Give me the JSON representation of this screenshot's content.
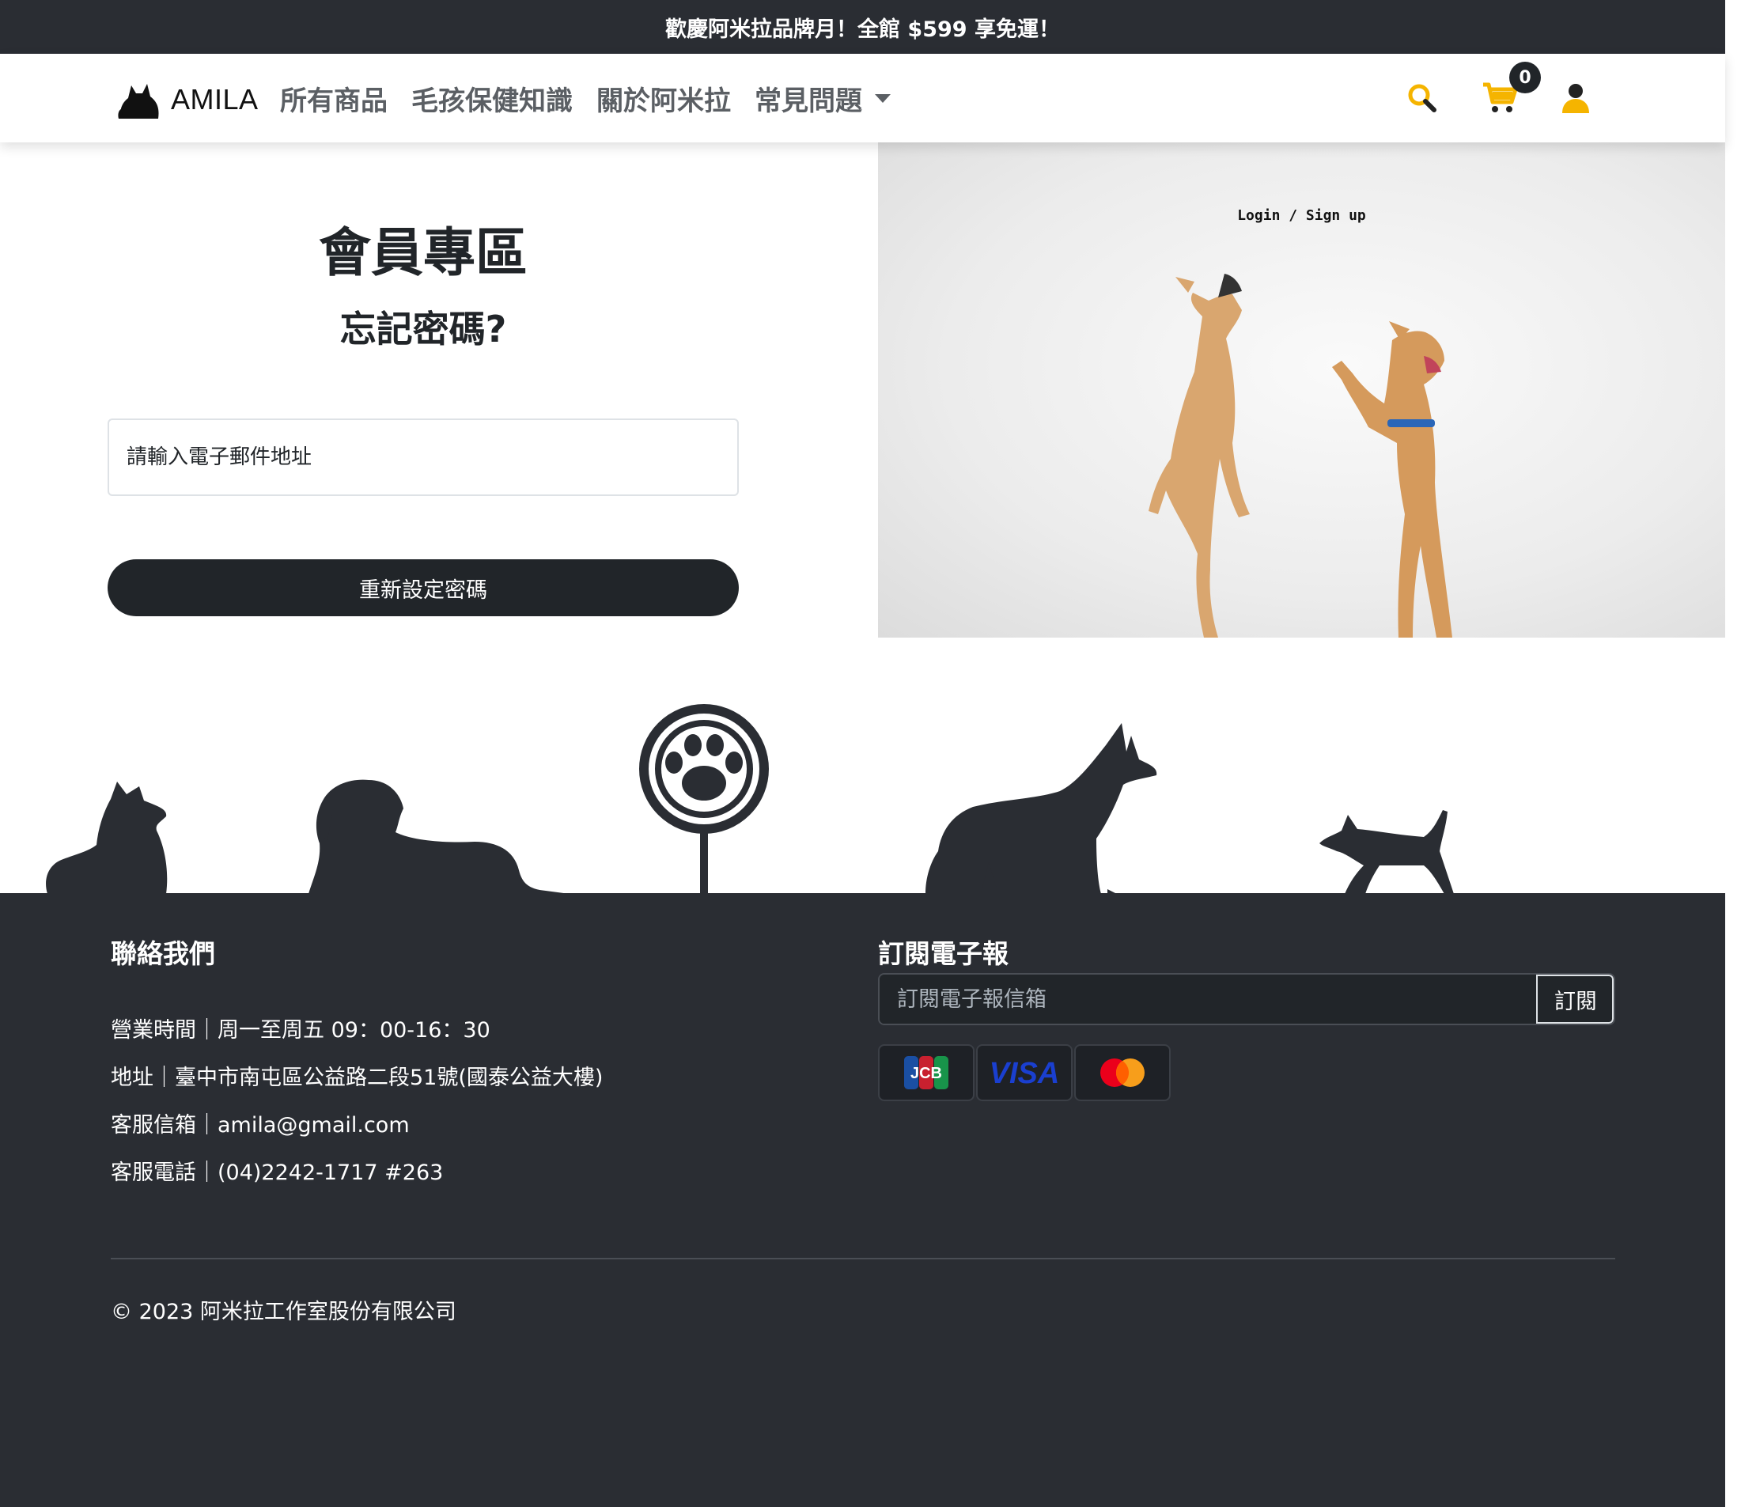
{
  "announcement": "歡慶阿米拉品牌月！全館 $599 享免運！",
  "brand": {
    "name": "AMILA"
  },
  "nav": {
    "links": [
      "所有商品",
      "毛孩保健知識",
      "關於阿米拉",
      "常見問題"
    ]
  },
  "cart": {
    "count": "0"
  },
  "icons": {
    "search": "search-icon",
    "cart": "cart-icon",
    "user": "user-icon",
    "logo": "cat-logo-icon"
  },
  "colors": {
    "dark": "#2a2d33",
    "accent": "#f5b400",
    "button": "#212529"
  },
  "main": {
    "title": "會員專區",
    "subtitle": "忘記密碼?",
    "email_placeholder": "請輸入電子郵件地址",
    "reset_button": "重新設定密碼",
    "hero_caption": "Login / Sign up"
  },
  "footer": {
    "contact": {
      "heading": "聯絡我們",
      "hours": "營業時間｜周一至周五 09：00-16：30",
      "address": "地址｜臺中市南屯區公益路二段51號(國泰公益大樓)",
      "email": "客服信箱｜amila@gmail.com",
      "phone": "客服電話｜(04)2242-1717 #263"
    },
    "newsletter": {
      "heading": "訂閱電子報",
      "placeholder": "訂閱電子報信箱",
      "button": "訂閱"
    },
    "payment_cards": [
      "JCB",
      "VISA",
      "Mastercard"
    ],
    "copyright": "© 2023 阿米拉工作室股份有限公司"
  }
}
